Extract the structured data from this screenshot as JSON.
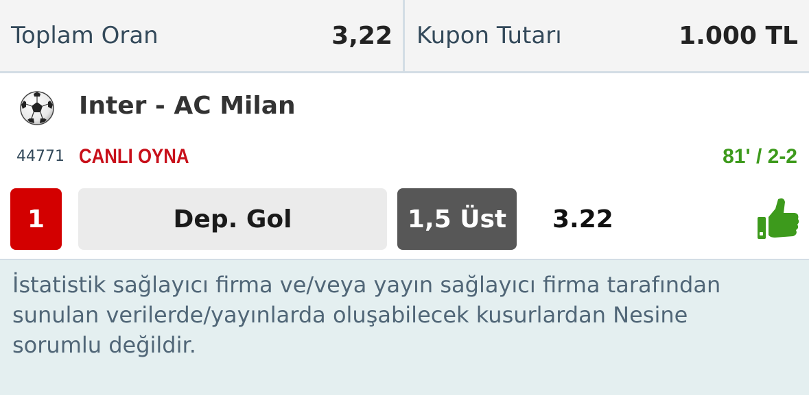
{
  "summary": {
    "total_odds_label": "Toplam Oran",
    "total_odds_value": "3,22",
    "coupon_amount_label": "Kupon Tutarı",
    "coupon_amount_value": "1.000 TL"
  },
  "match": {
    "sport_icon": "soccer-ball-icon",
    "title": "Inter - AC Milan",
    "code": "44771",
    "live_label": "CANLI OYNA",
    "live_status": "81' / 2-2"
  },
  "pick": {
    "number": "1",
    "market": "Dep. Gol",
    "selection": "1,5 Üst",
    "odd": "3.22",
    "status_icon": "thumbs-up-icon"
  },
  "colors": {
    "live": "#c8101a",
    "status_green": "#3d9a1c",
    "pick_number_bg": "#d30000",
    "selection_bg": "#575757"
  },
  "disclaimer": "İstatistik sağlayıcı firma ve/veya yayın sağlayıcı firma tarafından sunulan verilerde/yayınlarda oluşabilecek kusurlardan Nesine sorumlu değildir."
}
